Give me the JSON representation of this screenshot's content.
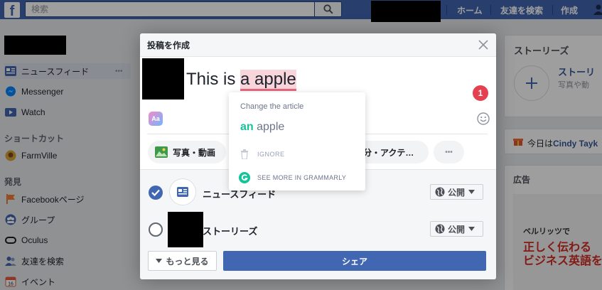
{
  "topbar": {
    "logo": "f",
    "search_placeholder": "検索",
    "nav": [
      "ホーム",
      "友達を検索",
      "作成"
    ]
  },
  "left_nav": {
    "items": [
      {
        "label": "ニュースフィード",
        "icon": "news-feed-icon"
      },
      {
        "label": "Messenger",
        "icon": "messenger-icon"
      },
      {
        "label": "Watch",
        "icon": "watch-icon"
      }
    ],
    "shortcuts_heading": "ショートカット",
    "shortcuts": [
      {
        "label": "FarmVille",
        "icon": "farmville-icon"
      }
    ],
    "explore_heading": "発見",
    "explore": [
      {
        "label": "Facebookページ",
        "icon": "flag-icon"
      },
      {
        "label": "グループ",
        "icon": "groups-icon"
      },
      {
        "label": "Oculus",
        "icon": "oculus-icon"
      },
      {
        "label": "友達を検索",
        "icon": "friends-icon"
      },
      {
        "label": "イベント",
        "icon": "calendar-icon"
      }
    ],
    "more_dots": "•••"
  },
  "right_col": {
    "stories_title": "ストーリーズ",
    "stories_add_title": "ストーリ",
    "stories_add_sub": "写真や動",
    "birthday_prefix": "今日は",
    "birthday_name": "Cindy Tayk",
    "ads_title": "広告",
    "ad_line1": "ベルリッツで",
    "ad_line2": "正しく伝わる",
    "ad_line3": "ビジネス英語を"
  },
  "dialog": {
    "title": "投稿を作成",
    "text_before": "This is ",
    "text_highlight": "a apple",
    "grammarly_count": "1",
    "aa_label": "Aa",
    "pills": [
      "写真・動画",
      "分・アクテ…"
    ],
    "pill_more": "•••",
    "audience": [
      {
        "label": "ニュースフィード",
        "checked": true,
        "privacy": "公開"
      },
      {
        "label": "ストーリーズ",
        "checked": false,
        "privacy": "公開"
      }
    ],
    "more_button": "もっと見る",
    "share_button": "シェア"
  },
  "grammarly_popup": {
    "title": "Change the article",
    "suggestion_add": "an",
    "suggestion_rest": " apple",
    "ignore": "IGNORE",
    "see_more": "SEE MORE IN GRAMMARLY"
  },
  "colors": {
    "facebook_blue": "#4267b2",
    "grammarly_green": "#15c39a",
    "grammarly_red": "#e5404f",
    "highlight": "#f8d4db"
  }
}
